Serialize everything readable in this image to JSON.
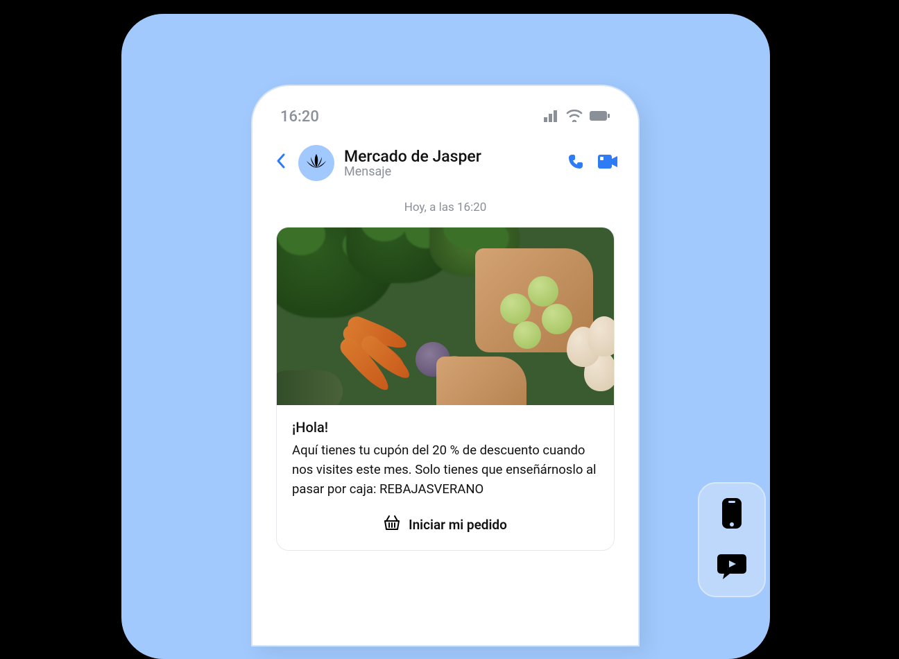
{
  "status": {
    "time": "16:20"
  },
  "chat": {
    "title": "Mercado de Jasper",
    "subtitle": "Mensaje"
  },
  "timestamp": "Hoy, a las 16:20",
  "message": {
    "greeting": "¡Hola!",
    "body": "Aquí tienes tu cupón del 20 % de descuento cuando nos visites este mes. Solo tienes que enseñárnoslo al pasar por caja: REBAJASVERANO",
    "cta": "Iniciar mi pedido"
  }
}
